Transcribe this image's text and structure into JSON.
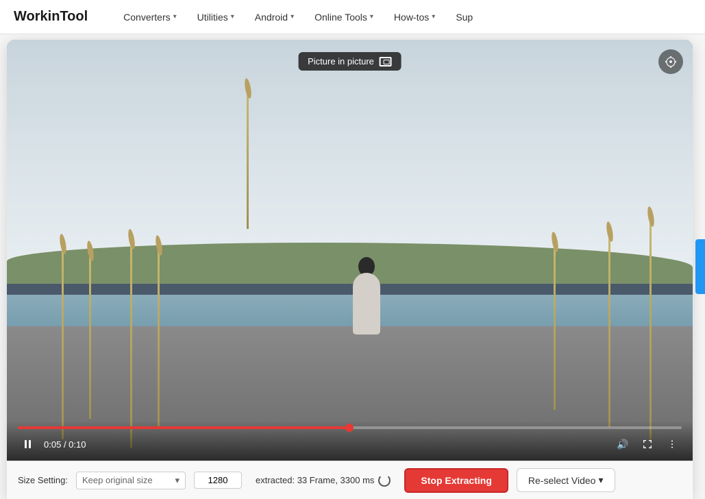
{
  "brand": "WorkinTool",
  "navbar": {
    "links": [
      {
        "label": "Converters",
        "id": "converters"
      },
      {
        "label": "Utilities",
        "id": "utilities"
      },
      {
        "label": "Android",
        "id": "android"
      },
      {
        "label": "Online Tools",
        "id": "online-tools"
      },
      {
        "label": "How-tos",
        "id": "how-tos"
      },
      {
        "label": "Sup",
        "id": "sup"
      }
    ]
  },
  "video_player": {
    "pip_tooltip": "Picture in picture",
    "time_current": "0:05",
    "time_total": "0:10",
    "progress_percent": 50
  },
  "bottom_toolbar": {
    "size_label": "Size Setting:",
    "size_option": "Keep original size",
    "size_value": "1280",
    "extracted_info": "extracted: 33 Frame, 3300 ms",
    "stop_btn_label": "Stop Extracting",
    "reselect_btn_label": "Re-select Video"
  }
}
